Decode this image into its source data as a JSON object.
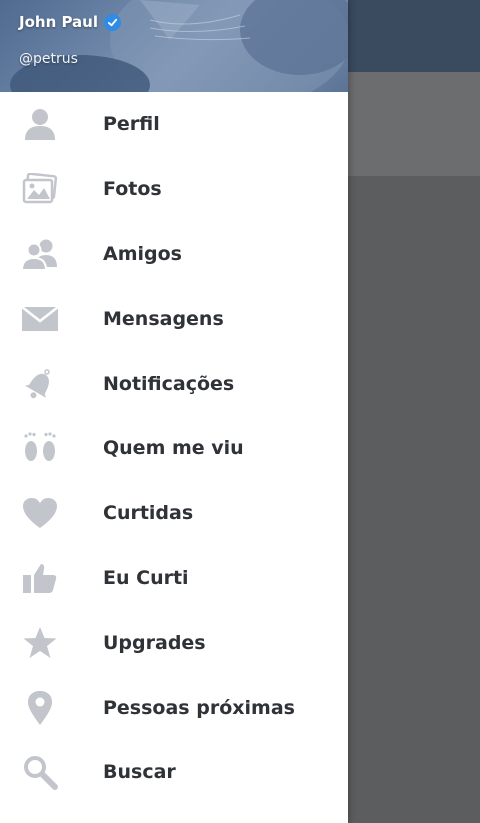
{
  "user": {
    "name": "John Paul",
    "handle": "@petrus",
    "verified": true
  },
  "menu": [
    {
      "id": "perfil",
      "label": "Perfil",
      "icon": "user-icon"
    },
    {
      "id": "fotos",
      "label": "Fotos",
      "icon": "photos-icon"
    },
    {
      "id": "amigos",
      "label": "Amigos",
      "icon": "friends-icon"
    },
    {
      "id": "mensagens",
      "label": "Mensagens",
      "icon": "envelope-icon"
    },
    {
      "id": "notificacoes",
      "label": "Notificações",
      "icon": "bell-icon"
    },
    {
      "id": "quem-me-viu",
      "label": "Quem me viu",
      "icon": "footprints-icon"
    },
    {
      "id": "curtidas",
      "label": "Curtidas",
      "icon": "heart-icon"
    },
    {
      "id": "eu-curti",
      "label": "Eu Curti",
      "icon": "thumbs-up-icon"
    },
    {
      "id": "upgrades",
      "label": "Upgrades",
      "icon": "star-icon"
    },
    {
      "id": "pessoas-proximas",
      "label": "Pessoas próximas",
      "icon": "map-pin-icon"
    },
    {
      "id": "buscar",
      "label": "Buscar",
      "icon": "search-icon"
    }
  ],
  "colors": {
    "icon_gray": "#c2c6cc",
    "label_text": "#2f3237",
    "verified_blue": "#2e8be6",
    "overlay": "#5b5d5f",
    "appbar": "#3a4a5f"
  }
}
